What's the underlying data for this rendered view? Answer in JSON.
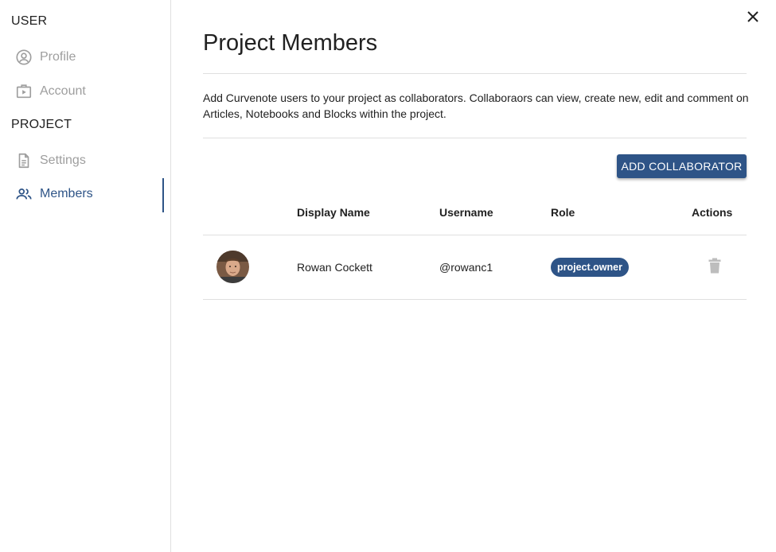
{
  "sidebar": {
    "user_header": "USER",
    "project_header": "PROJECT",
    "items": [
      {
        "label": "Profile",
        "icon": "account-circle-icon"
      },
      {
        "label": "Account",
        "icon": "account-box-icon"
      },
      {
        "label": "Settings",
        "icon": "document-icon"
      },
      {
        "label": "Members",
        "icon": "people-icon",
        "active": true
      }
    ]
  },
  "main": {
    "title": "Project Members",
    "description": "Add Curvenote users to your project as collaborators. Collaboraors can view, create new, edit and comment on Articles, Notebooks and Blocks within the project.",
    "add_button": "ADD COLLABORATOR",
    "table": {
      "headers": [
        "Display Name",
        "Username",
        "Role",
        "Actions"
      ],
      "rows": [
        {
          "display_name": "Rowan Cockett",
          "username": "@rowanc1",
          "role": "project.owner"
        }
      ]
    }
  },
  "colors": {
    "accent": "#2e5487",
    "muted_text": "#9e9e9e",
    "divider": "#e0e0e0",
    "delete_icon": "#bdbdbd"
  }
}
